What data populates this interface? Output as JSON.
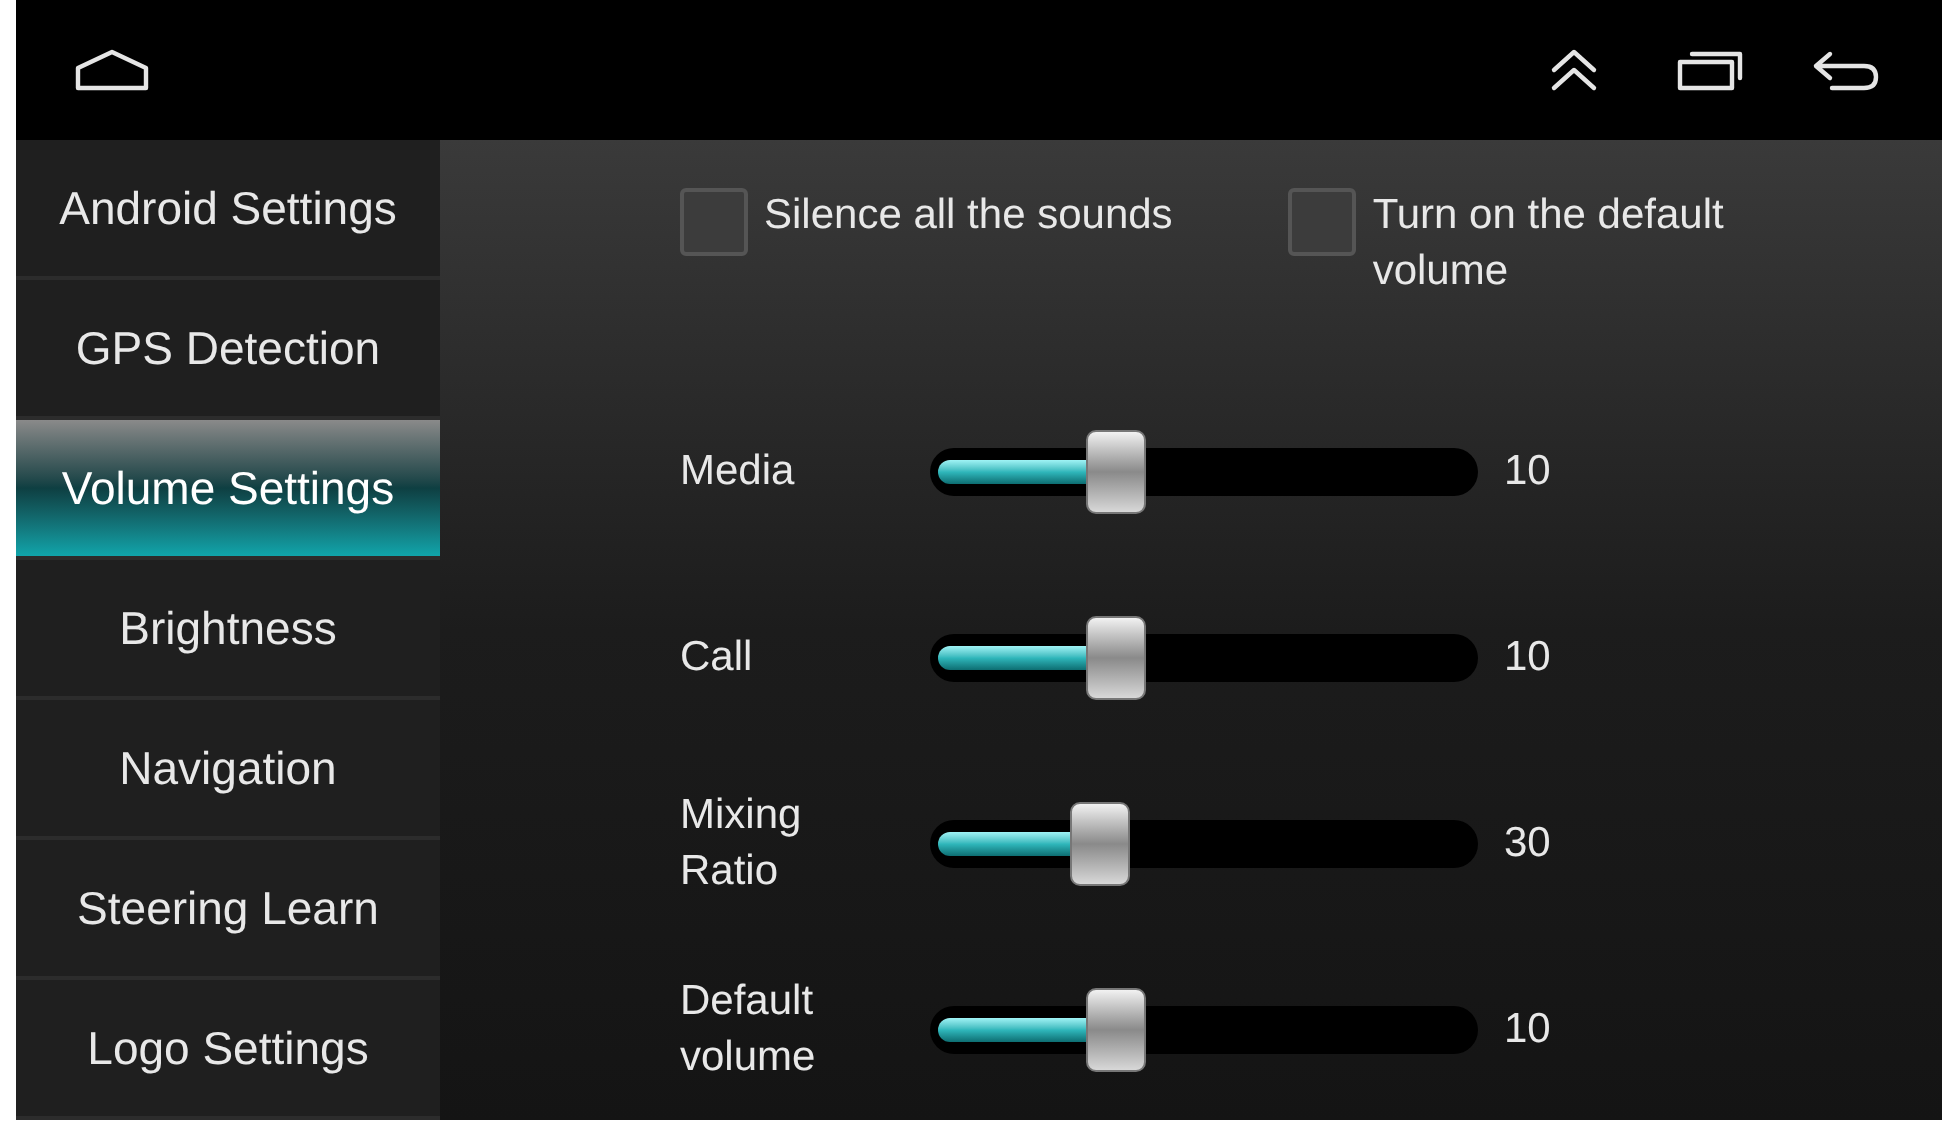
{
  "nav_bar": {
    "buttons": [
      {
        "kind": "home"
      },
      {
        "kind": "up"
      },
      {
        "kind": "recent"
      },
      {
        "kind": "back"
      }
    ]
  },
  "sidebar": {
    "items": [
      {
        "label": "Android Settings",
        "selected": false
      },
      {
        "label": "GPS Detection",
        "selected": false
      },
      {
        "label": "Volume Settings",
        "selected": true
      },
      {
        "label": "Brightness",
        "selected": false
      },
      {
        "label": "Navigation",
        "selected": false
      },
      {
        "label": "Steering Learn",
        "selected": false
      },
      {
        "label": "Logo Settings",
        "selected": false
      }
    ]
  },
  "options": [
    {
      "label": "Silence all the sounds",
      "checked": false
    },
    {
      "label": "Turn on the default volume",
      "checked": false
    }
  ],
  "sliders": [
    {
      "label": "Media",
      "level": 0.34,
      "reading": "10"
    },
    {
      "label": "Call",
      "level": 0.34,
      "reading": "10"
    },
    {
      "label": "Mixing Ratio",
      "level": 0.31,
      "reading": "30"
    },
    {
      "label": "Default volume",
      "level": 0.34,
      "reading": "10"
    }
  ]
}
